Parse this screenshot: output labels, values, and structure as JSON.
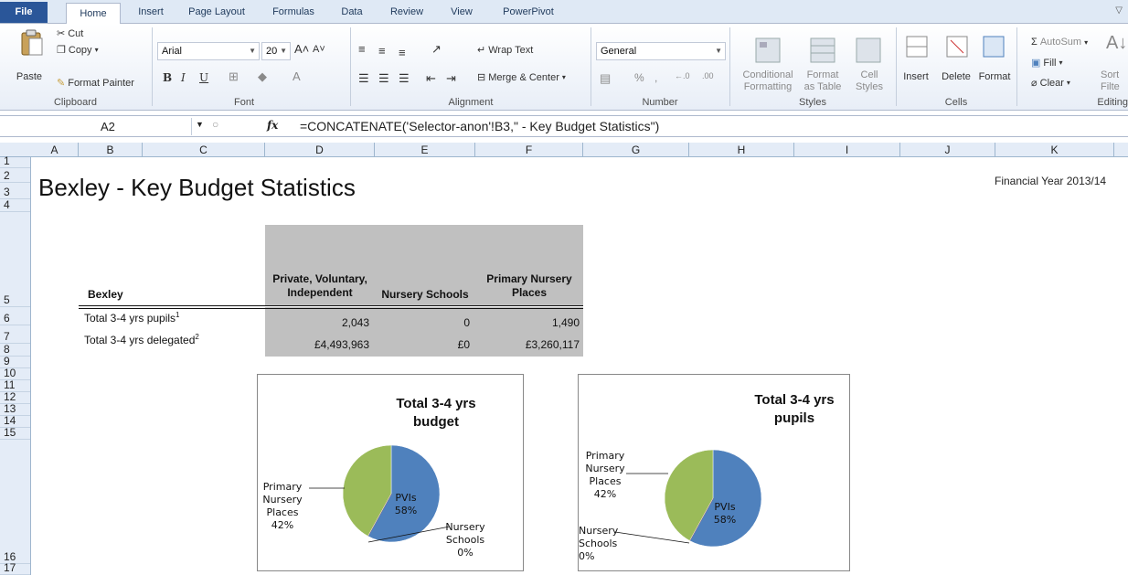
{
  "ribbon_tabs": [
    "File",
    "Home",
    "Insert",
    "Page Layout",
    "Formulas",
    "Data",
    "Review",
    "View",
    "PowerPivot"
  ],
  "clipboard": {
    "paste": "Paste",
    "cut": "Cut",
    "copy": "Copy",
    "format_painter": "Format Painter",
    "label": "Clipboard"
  },
  "font": {
    "name": "Arial",
    "size": "20",
    "label": "Font"
  },
  "alignment": {
    "wrap_text": "Wrap Text",
    "merge_center": "Merge & Center",
    "label": "Alignment"
  },
  "number": {
    "format": "General",
    "label": "Number"
  },
  "styles": {
    "conditional_formatting": "Conditional\nFormatting",
    "format_as_table": "Format\nas Table",
    "cell_styles": "Cell\nStyles",
    "label": "Styles"
  },
  "cells": {
    "insert": "Insert",
    "delete": "Delete",
    "format": "Format",
    "label": "Cells"
  },
  "editing": {
    "autosum": "AutoSum",
    "fill": "Fill",
    "clear": "Clear",
    "sort_filter": "Sort\nFilte",
    "label": "Editing"
  },
  "formula_bar": {
    "name_box": "A2",
    "fx": "fx",
    "formula": "=CONCATENATE('Selector-anon'!B3,\" - Key Budget Statistics\")"
  },
  "columns": [
    "A",
    "B",
    "C",
    "D",
    "E",
    "F",
    "G",
    "H",
    "I",
    "J",
    "K"
  ],
  "rows": [
    "1",
    "2",
    "3",
    "4",
    "5",
    "6",
    "7",
    "8",
    "9",
    "10",
    "11",
    "12",
    "13",
    "14",
    "15",
    "16",
    "17"
  ],
  "sheet": {
    "title": "Bexley - Key Budget Statistics",
    "financial_year": "Financial Year 2013/14",
    "table": {
      "row_header": "Bexley",
      "col_headers": [
        "Private, Voluntary, Independent",
        "Nursery Schools",
        "Primary Nursery Places"
      ],
      "rows": [
        {
          "label": "Total 3-4 yrs pupils",
          "sup": "1",
          "values": [
            "2,043",
            "0",
            "1,490"
          ]
        },
        {
          "label": "Total 3-4 yrs delegated",
          "sup": "2",
          "values": [
            "£4,493,963",
            "£0",
            "£3,260,117"
          ]
        }
      ]
    }
  },
  "chart_data": [
    {
      "type": "pie",
      "title": "Total 3-4 yrs budget",
      "categories": [
        "PVIs",
        "Nursery Schools",
        "Primary Nursery Places"
      ],
      "values": [
        58,
        0,
        42
      ],
      "labels": [
        "PVIs\n58%",
        "Nursery\nSchools\n0%",
        "Primary\nNursery\nPlaces\n42%"
      ],
      "colors": [
        "#4f81bd",
        "#c0504d",
        "#9bbb59"
      ]
    },
    {
      "type": "pie",
      "title": "Total 3-4 yrs pupils",
      "categories": [
        "PVIs",
        "Nursery Schools",
        "Primary Nursery Places"
      ],
      "values": [
        58,
        0,
        42
      ],
      "labels": [
        "PVIs\n58%",
        "Nursery\nSchools\n0%",
        "Primary\nNursery\nPlaces\n42%"
      ],
      "colors": [
        "#4f81bd",
        "#c0504d",
        "#9bbb59"
      ]
    }
  ]
}
